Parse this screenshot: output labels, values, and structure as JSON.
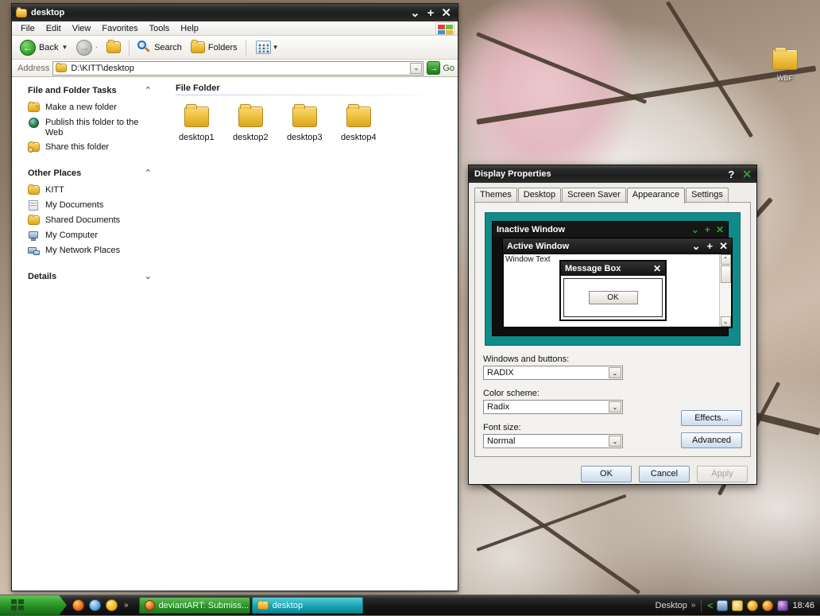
{
  "explorer": {
    "title": "desktop",
    "title_icon": "folder-icon",
    "window_buttons": {
      "minimize": "⌄",
      "maximize": "+",
      "close": "✕"
    },
    "menu": [
      "File",
      "Edit",
      "View",
      "Favorites",
      "Tools",
      "Help"
    ],
    "toolbar": {
      "back": "Back",
      "back_dropdown": "▼",
      "forward_sep": "·",
      "search": "Search",
      "folders": "Folders",
      "views_dropdown": "▼"
    },
    "address": {
      "label": "Address",
      "value": "D:\\KITT\\desktop",
      "dropdown": "⌄",
      "go_label": "Go",
      "go_arrow": "→"
    },
    "sidebar": {
      "panels": [
        {
          "title": "File and Folder Tasks",
          "chevron": "⌃",
          "items": [
            {
              "label": "Make a new folder",
              "icon": "new-folder-icon"
            },
            {
              "label": "Publish this folder to the Web",
              "icon": "globe-icon"
            },
            {
              "label": "Share this folder",
              "icon": "shared-folder-icon"
            }
          ]
        },
        {
          "title": "Other Places",
          "chevron": "⌃",
          "items": [
            {
              "label": "KITT",
              "icon": "folder-icon"
            },
            {
              "label": "My Documents",
              "icon": "documents-icon"
            },
            {
              "label": "Shared Documents",
              "icon": "folder-icon"
            },
            {
              "label": "My Computer",
              "icon": "computer-icon"
            },
            {
              "label": "My Network Places",
              "icon": "network-icon"
            }
          ]
        },
        {
          "title": "Details",
          "chevron": "⌄",
          "items": []
        }
      ]
    },
    "content": {
      "group_header": "File Folder",
      "items": [
        {
          "label": "desktop1",
          "icon": "folder-icon"
        },
        {
          "label": "desktop2",
          "icon": "folder-icon"
        },
        {
          "label": "desktop3",
          "icon": "folder-icon"
        },
        {
          "label": "desktop4",
          "icon": "folder-icon"
        }
      ]
    }
  },
  "dialog": {
    "title": "Display Properties",
    "help_button": "?",
    "close_button": "✕",
    "tabs": [
      {
        "label": "Themes",
        "active": false
      },
      {
        "label": "Desktop",
        "active": false
      },
      {
        "label": "Screen Saver",
        "active": false
      },
      {
        "label": "Appearance",
        "active": true
      },
      {
        "label": "Settings",
        "active": false
      }
    ],
    "preview": {
      "inactive_window": {
        "title": "Inactive Window",
        "buttons": {
          "minimize": "⌄",
          "maximize": "+",
          "close": "✕"
        }
      },
      "active_window": {
        "title": "Active Window",
        "buttons": {
          "minimize": "⌄",
          "maximize": "+",
          "close": "✕"
        },
        "body_text": "Window Text",
        "scroll_up": "⌃",
        "scroll_down": "⌄"
      },
      "message_box": {
        "title": "Message Box",
        "close": "✕",
        "ok_label": "OK"
      }
    },
    "fields": [
      {
        "label": "Windows and buttons:",
        "value": "RADIX",
        "dropdown": "⌄"
      },
      {
        "label": "Color scheme:",
        "value": "Radix",
        "dropdown": "⌄"
      },
      {
        "label": "Font size:",
        "value": "Normal",
        "dropdown": "⌄"
      }
    ],
    "side_buttons": [
      {
        "label": "Effects...",
        "enabled": true
      },
      {
        "label": "Advanced",
        "enabled": true
      }
    ],
    "footer_buttons": [
      {
        "label": "OK",
        "enabled": true
      },
      {
        "label": "Cancel",
        "enabled": true
      },
      {
        "label": "Apply",
        "enabled": false
      }
    ],
    "colors": {
      "preview_background": "#118a8a",
      "close_green": "#2ea02e"
    }
  },
  "desktop": {
    "icons": [
      {
        "label": "WBF",
        "icon": "folder-icon"
      }
    ]
  },
  "taskbar": {
    "start_label": "",
    "quicklaunch_chevron": "»",
    "tasks": [
      {
        "label": "deviantART: Submiss...",
        "icon": "firefox-icon",
        "active": false
      },
      {
        "label": "desktop",
        "icon": "folder-icon",
        "active": true
      }
    ],
    "tray": {
      "label": "Desktop",
      "chevron": "»",
      "clock": "18:46"
    },
    "colors": {
      "start_green": "#2f9c2c",
      "active_task": "#19a3b2"
    }
  }
}
